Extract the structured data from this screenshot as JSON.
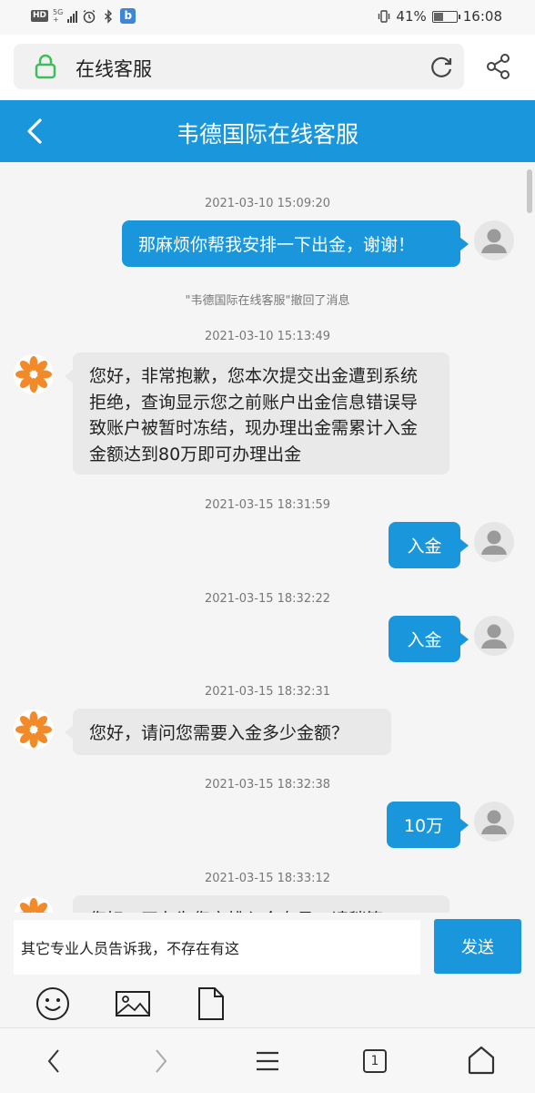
{
  "status_bar": {
    "hd": "HD",
    "network": "5G",
    "network_sub": "+",
    "battery": "41%",
    "battery_level": 0.41,
    "time": "16:08",
    "app_badge": "b"
  },
  "address_bar": {
    "url_text": "在线客服"
  },
  "header": {
    "title": "韦德国际在线客服"
  },
  "messages": [
    {
      "type": "timestamp",
      "text": "2021-03-10 15:09:20"
    },
    {
      "type": "out",
      "text": "那麻烦你帮我安排一下出金，谢谢！"
    },
    {
      "type": "notice",
      "text": "\"韦德国际在线客服\"撤回了消息"
    },
    {
      "type": "timestamp",
      "text": "2021-03-10 15:13:49"
    },
    {
      "type": "in",
      "text": "您好，非常抱歉，您本次提交出金遭到系统拒绝，查询显示您之前账户出金信息错误导致账户被暂时冻结，现办理出金需累计入金金额达到80万即可办理出金"
    },
    {
      "type": "timestamp",
      "text": "2021-03-15 18:31:59"
    },
    {
      "type": "out",
      "text": "入金"
    },
    {
      "type": "timestamp",
      "text": "2021-03-15 18:32:22"
    },
    {
      "type": "out",
      "text": "入金"
    },
    {
      "type": "timestamp",
      "text": "2021-03-15 18:32:31"
    },
    {
      "type": "in",
      "text": "您好，请问您需要入金多少金额？"
    },
    {
      "type": "timestamp",
      "text": "2021-03-15 18:32:38"
    },
    {
      "type": "out",
      "text": "10万"
    },
    {
      "type": "timestamp",
      "text": "2021-03-15 18:33:12"
    },
    {
      "type": "in",
      "text": "您好，正在为您安排入金专员，请稍等"
    }
  ],
  "input": {
    "value": "其它专业人员告诉我，不存在有这",
    "send_label": "发送"
  },
  "bottom_nav": {
    "tab_count": "1"
  },
  "colors": {
    "accent": "#1a97dc",
    "incoming_bubble": "#e9e9e9",
    "background": "#f5f5f5",
    "agent_avatar": "#f28a2a"
  },
  "icons": {
    "lock": "lock-icon",
    "refresh": "refresh-icon",
    "share": "share-icon",
    "back": "chevron-left-icon",
    "emoji": "smiley-icon",
    "image": "image-icon",
    "file": "file-icon",
    "nav_back": "chevron-left-icon",
    "nav_forward": "chevron-right-icon",
    "menu": "menu-icon",
    "tabs": "tabs-icon",
    "home": "home-icon"
  }
}
